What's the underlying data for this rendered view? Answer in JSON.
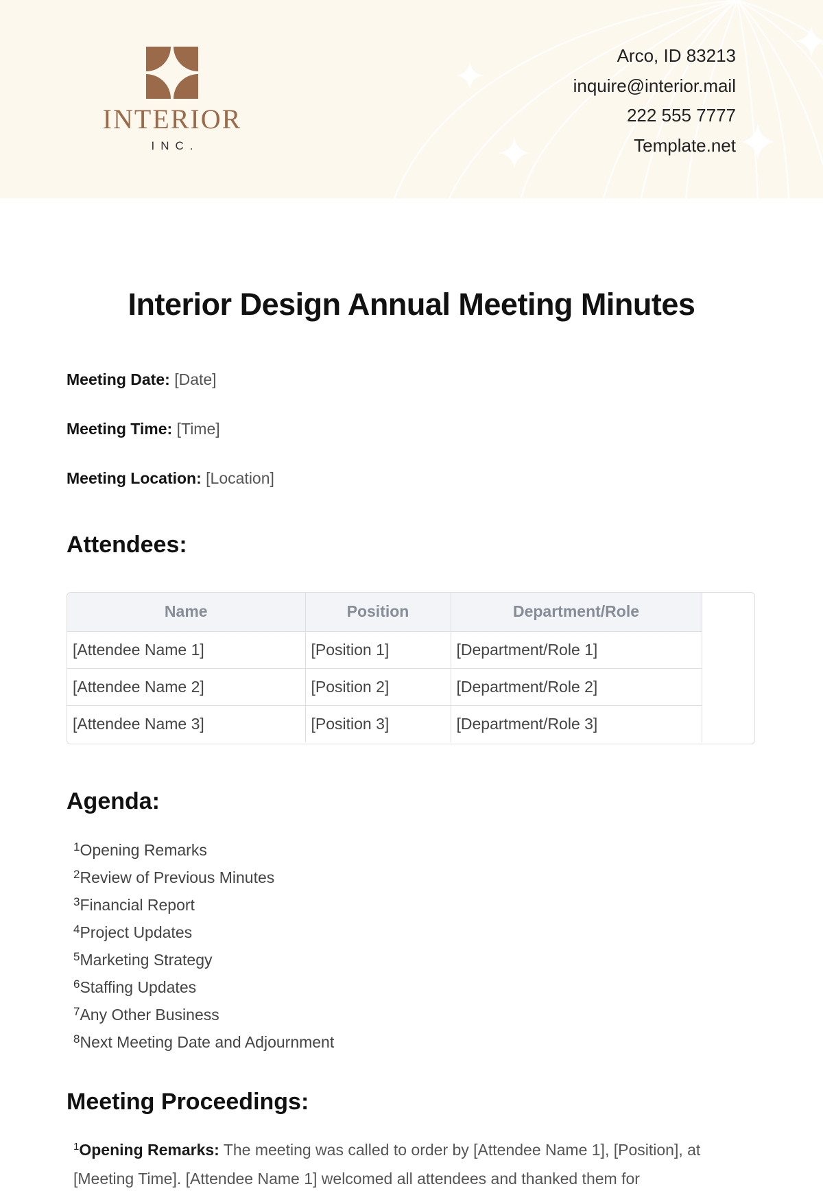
{
  "header": {
    "logo": {
      "wordmark": "INTERIOR",
      "subtitle": "INC.",
      "color": "#9a6a4a"
    },
    "contact": {
      "address": "Arco, ID 83213",
      "email": "inquire@interior.mail",
      "phone": "222 555 7777",
      "website": "Template.net"
    },
    "background": "#fdf8ee"
  },
  "document": {
    "title": "Interior Design Annual Meeting Minutes",
    "meta": [
      {
        "label": "Meeting Date:",
        "value": "[Date]"
      },
      {
        "label": "Meeting Time:",
        "value": "[Time]"
      },
      {
        "label": "Meeting Location:",
        "value": "[Location]"
      }
    ]
  },
  "attendees": {
    "heading": "Attendees:",
    "columns": [
      "Name",
      "Position",
      "Department/Role"
    ],
    "rows": [
      [
        "[Attendee Name 1]",
        "[Position 1]",
        "[Department/Role 1]"
      ],
      [
        "[Attendee Name 2]",
        "[Position 2]",
        "[Department/Role 2]"
      ],
      [
        "[Attendee Name 3]",
        "[Position 3]",
        "[Department/Role 3]"
      ]
    ]
  },
  "agenda": {
    "heading": "Agenda:",
    "items": [
      {
        "num": "1",
        "text": "Opening Remarks"
      },
      {
        "num": "2",
        "text": "Review of Previous Minutes"
      },
      {
        "num": "3",
        "text": "Financial Report"
      },
      {
        "num": "4",
        "text": "Project Updates"
      },
      {
        "num": "5",
        "text": "Marketing Strategy"
      },
      {
        "num": "6",
        "text": "Staffing Updates"
      },
      {
        "num": "7",
        "text": "Any Other Business"
      },
      {
        "num": "8",
        "text": "Next Meeting Date and Adjournment"
      }
    ]
  },
  "proceedings": {
    "heading": "Meeting Proceedings:",
    "items": [
      {
        "num": "1",
        "label": "Opening Remarks:",
        "text": " The meeting was called to order by [Attendee Name 1], [Position], at [Meeting Time]. [Attendee Name 1] welcomed all attendees and thanked them for"
      }
    ]
  }
}
